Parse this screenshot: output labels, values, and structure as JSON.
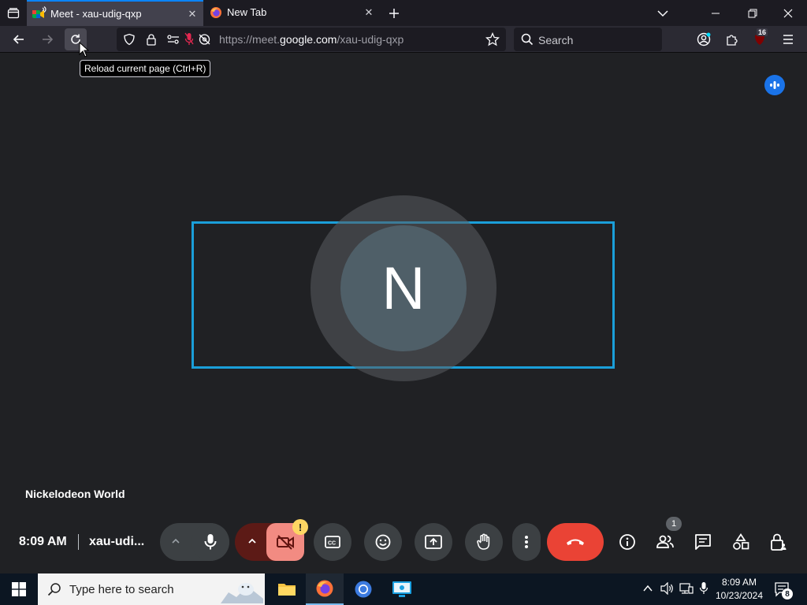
{
  "browser": {
    "tabs": [
      {
        "title": "Meet - xau-udig-qxp",
        "active": true
      },
      {
        "title": "New Tab",
        "active": false
      }
    ],
    "url_prefix": "https://meet.",
    "url_domain": "google.com",
    "url_path": "/xau-udig-qxp",
    "search_placeholder": "Search",
    "extensions_badge": "16",
    "tooltip": "Reload current page (Ctrl+R)"
  },
  "meet": {
    "avatar_letter": "N",
    "participant_name": "Nickelodeon World",
    "time": "8:09 AM",
    "separator": "|",
    "meeting_code": "xau-udi...",
    "camera_warning": "!",
    "people_count": "1",
    "colors": {
      "active_speaker_border": "#1a9fd9",
      "end_call": "#ea4335",
      "camera_off": "#f28b82",
      "avatar": "#4f5f68"
    }
  },
  "taskbar": {
    "search_placeholder": "Type here to search",
    "time": "8:09 AM",
    "date": "10/23/2024",
    "notification_count": "8"
  }
}
